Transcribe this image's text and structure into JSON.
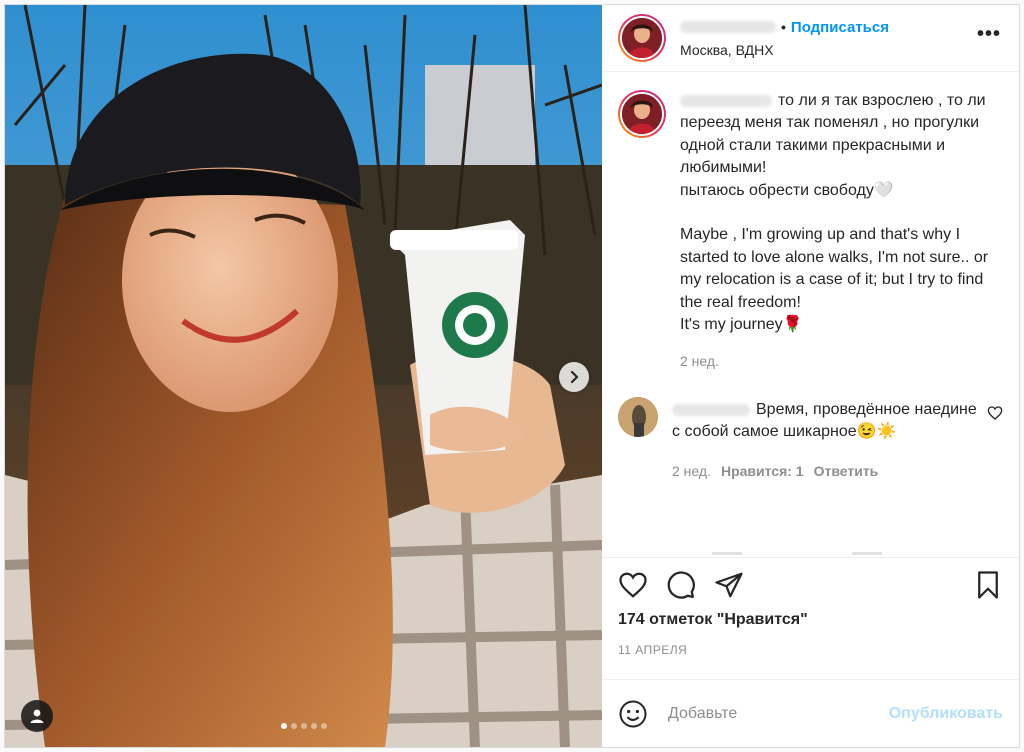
{
  "header": {
    "follow_label": "Подписаться",
    "separator": "•",
    "location": "Москва, ВДНХ",
    "more_label": "•••"
  },
  "caption": {
    "text": "то ли я так взрослею , то ли переезд меня так поменял , но прогулки одной стали такими прекрасными и любимыми!\nпытаюсь обрести свободу🤍\n\nMaybe , I'm growing up and that's why I started to love alone walks, I'm not sure.. or my relocation is a case of it; but I try to find the real freedom!\nIt's my journey🌹",
    "time": "2 нед."
  },
  "comment": {
    "text": "Время, проведённое наедине с собой самое шикарное😉☀️",
    "time": "2 нед.",
    "likes": "Нравится: 1",
    "reply_label": "Ответить"
  },
  "post": {
    "likes_text": "174 отметок \"Нравится\"",
    "date": "11 АПРЕЛЯ"
  },
  "add_comment": {
    "placeholder": "Добавьте",
    "publish_label": "Опубликовать"
  },
  "carousel": {
    "total": 5,
    "current": 1
  },
  "colors": {
    "link_blue": "#0095f6",
    "publish_disabled": "#b2dffc",
    "muted": "#8e8e8e",
    "text": "#262626"
  }
}
